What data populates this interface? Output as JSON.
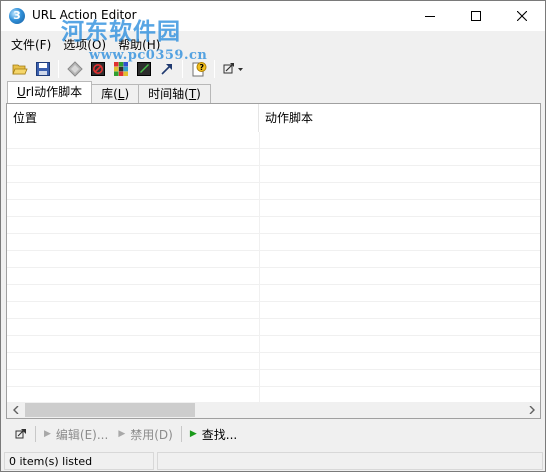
{
  "window": {
    "title": "URL Action Editor",
    "watermark_main": "河东软件园",
    "watermark_url": "www.pc0359.cn"
  },
  "menu": [
    {
      "label": "文件(F)"
    },
    {
      "label": "选项(O)"
    },
    {
      "label": "帮助(H)"
    }
  ],
  "toolbar": {
    "buttons": [
      "open-icon",
      "save-icon",
      "diamond-icon",
      "stop-script-icon",
      "grid-icon",
      "edit-script-icon",
      "arrow-icon",
      "help-icon",
      "link-dropdown-icon"
    ]
  },
  "tabs": [
    {
      "label_u": "U",
      "label_rest": "rl动作脚本",
      "active": true
    },
    {
      "label_pre": "库(",
      "label_u": "L",
      "label_post": ")",
      "active": false
    },
    {
      "label_pre": "时间轴(",
      "label_u": "T",
      "label_post": ")",
      "active": false
    }
  ],
  "list": {
    "columns": [
      "位置",
      "动作脚本"
    ],
    "rows": []
  },
  "actions": {
    "edit": "编辑(E)...",
    "disable": "禁用(D)",
    "find": "查找..."
  },
  "status": {
    "text": "0 item(s) listed"
  }
}
